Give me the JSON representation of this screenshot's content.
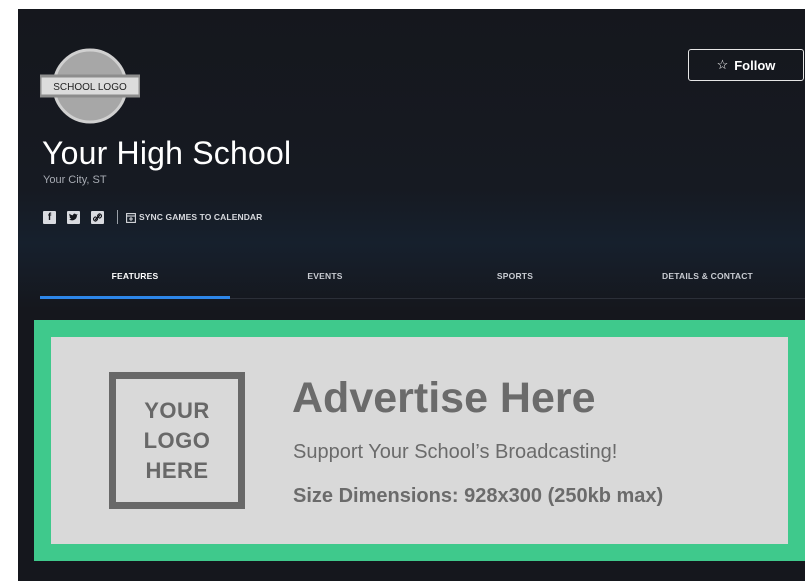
{
  "school": {
    "logo_text": "SCHOOL LOGO",
    "name": "Your High School",
    "location": "Your City, ST"
  },
  "actions": {
    "follow_icon": "☆",
    "follow_label": "Follow"
  },
  "social": {
    "facebook_glyph": "f",
    "twitter_glyph": "🐦",
    "link_glyph": "🔗",
    "sync_label": "SYNC GAMES TO CALENDAR"
  },
  "tabs": [
    {
      "label": "FEATURES",
      "active": true
    },
    {
      "label": "EVENTS",
      "active": false
    },
    {
      "label": "SPORTS",
      "active": false
    },
    {
      "label": "DETAILS & CONTACT",
      "active": false
    }
  ],
  "ad": {
    "logo_lines": [
      "YOUR",
      "LOGO",
      "HERE"
    ],
    "title": "Advertise Here",
    "subtitle": "Support Your School’s Broadcasting!",
    "size_text": "Size Dimensions: 928x300 (250kb max)"
  },
  "colors": {
    "background": "#15171d",
    "accent_tab": "#2d86e8",
    "ad_border": "#3fc98c",
    "ad_fill": "#d9d9d9",
    "ad_text": "#6b6b6b"
  }
}
